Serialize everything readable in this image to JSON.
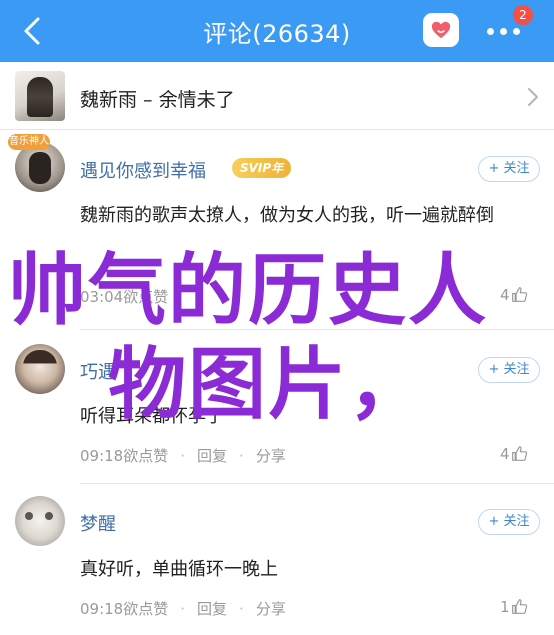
{
  "header": {
    "title": "评论(26634)",
    "badge_count": "2",
    "color": "#3b9af3"
  },
  "song": {
    "title": "魏新雨 – 余情未了"
  },
  "comments": [
    {
      "user": "遇见你感到幸福",
      "vip_badge": "SVIP年",
      "avatar_badge": "音乐神人",
      "follow": "+ 关注",
      "text": "魏新雨的歌声太撩人，做为女人的我，听一遍就醉倒",
      "time": "03:04",
      "reply": "欲点赞",
      "like_count": "4"
    },
    {
      "user": "巧遇",
      "follow": "+ 关注",
      "text": "听得耳朵都怀孕了",
      "time": "09:18",
      "reply_label": "欲点赞",
      "reply": "回复",
      "share": "分享",
      "like_count": "4"
    },
    {
      "user": "梦醒",
      "follow": "+ 关注",
      "text": "真好听，单曲循环一晚上",
      "time": "09:18",
      "reply_label": "欲点赞",
      "reply": "回复",
      "share": "分享",
      "like_count": "1"
    }
  ],
  "overlay": {
    "line1": "帅气的历史人",
    "line2": "物图片，",
    "color": "#8a2bd6"
  }
}
